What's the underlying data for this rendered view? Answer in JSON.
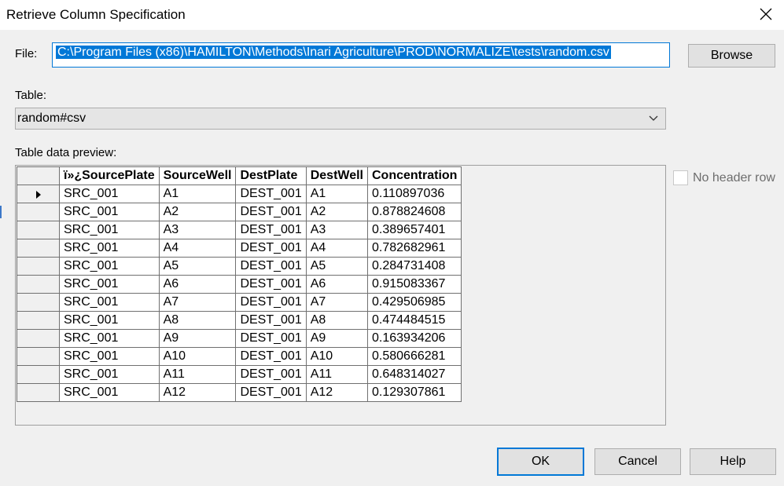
{
  "window": {
    "title": "Retrieve Column Specification"
  },
  "file": {
    "label": "File:",
    "value": "C:\\Program Files (x86)\\HAMILTON\\Methods\\Inari Agriculture\\PROD\\NORMALIZE\\tests\\random.csv",
    "browse_label": "Browse"
  },
  "table": {
    "label": "Table:",
    "selected": "random#csv"
  },
  "preview": {
    "label": "Table data preview:",
    "columns": [
      "ï»¿SourcePlate",
      "SourceWell",
      "DestPlate",
      "DestWell",
      "Concentration"
    ],
    "rows": [
      [
        "SRC_001",
        "A1",
        "DEST_001",
        "A1",
        "0.110897036"
      ],
      [
        "SRC_001",
        "A2",
        "DEST_001",
        "A2",
        "0.878824608"
      ],
      [
        "SRC_001",
        "A3",
        "DEST_001",
        "A3",
        "0.389657401"
      ],
      [
        "SRC_001",
        "A4",
        "DEST_001",
        "A4",
        "0.782682961"
      ],
      [
        "SRC_001",
        "A5",
        "DEST_001",
        "A5",
        "0.284731408"
      ],
      [
        "SRC_001",
        "A6",
        "DEST_001",
        "A6",
        "0.915083367"
      ],
      [
        "SRC_001",
        "A7",
        "DEST_001",
        "A7",
        "0.429506985"
      ],
      [
        "SRC_001",
        "A8",
        "DEST_001",
        "A8",
        "0.474484515"
      ],
      [
        "SRC_001",
        "A9",
        "DEST_001",
        "A9",
        "0.163934206"
      ],
      [
        "SRC_001",
        "A10",
        "DEST_001",
        "A10",
        "0.580666281"
      ],
      [
        "SRC_001",
        "A11",
        "DEST_001",
        "A11",
        "0.648314027"
      ],
      [
        "SRC_001",
        "A12",
        "DEST_001",
        "A12",
        "0.129307861"
      ]
    ]
  },
  "options": {
    "no_header_label": "No header row",
    "no_header_checked": false
  },
  "buttons": {
    "ok": "OK",
    "cancel": "Cancel",
    "help": "Help"
  },
  "colors": {
    "accent": "#0078d7",
    "background": "#f0f0f0"
  }
}
